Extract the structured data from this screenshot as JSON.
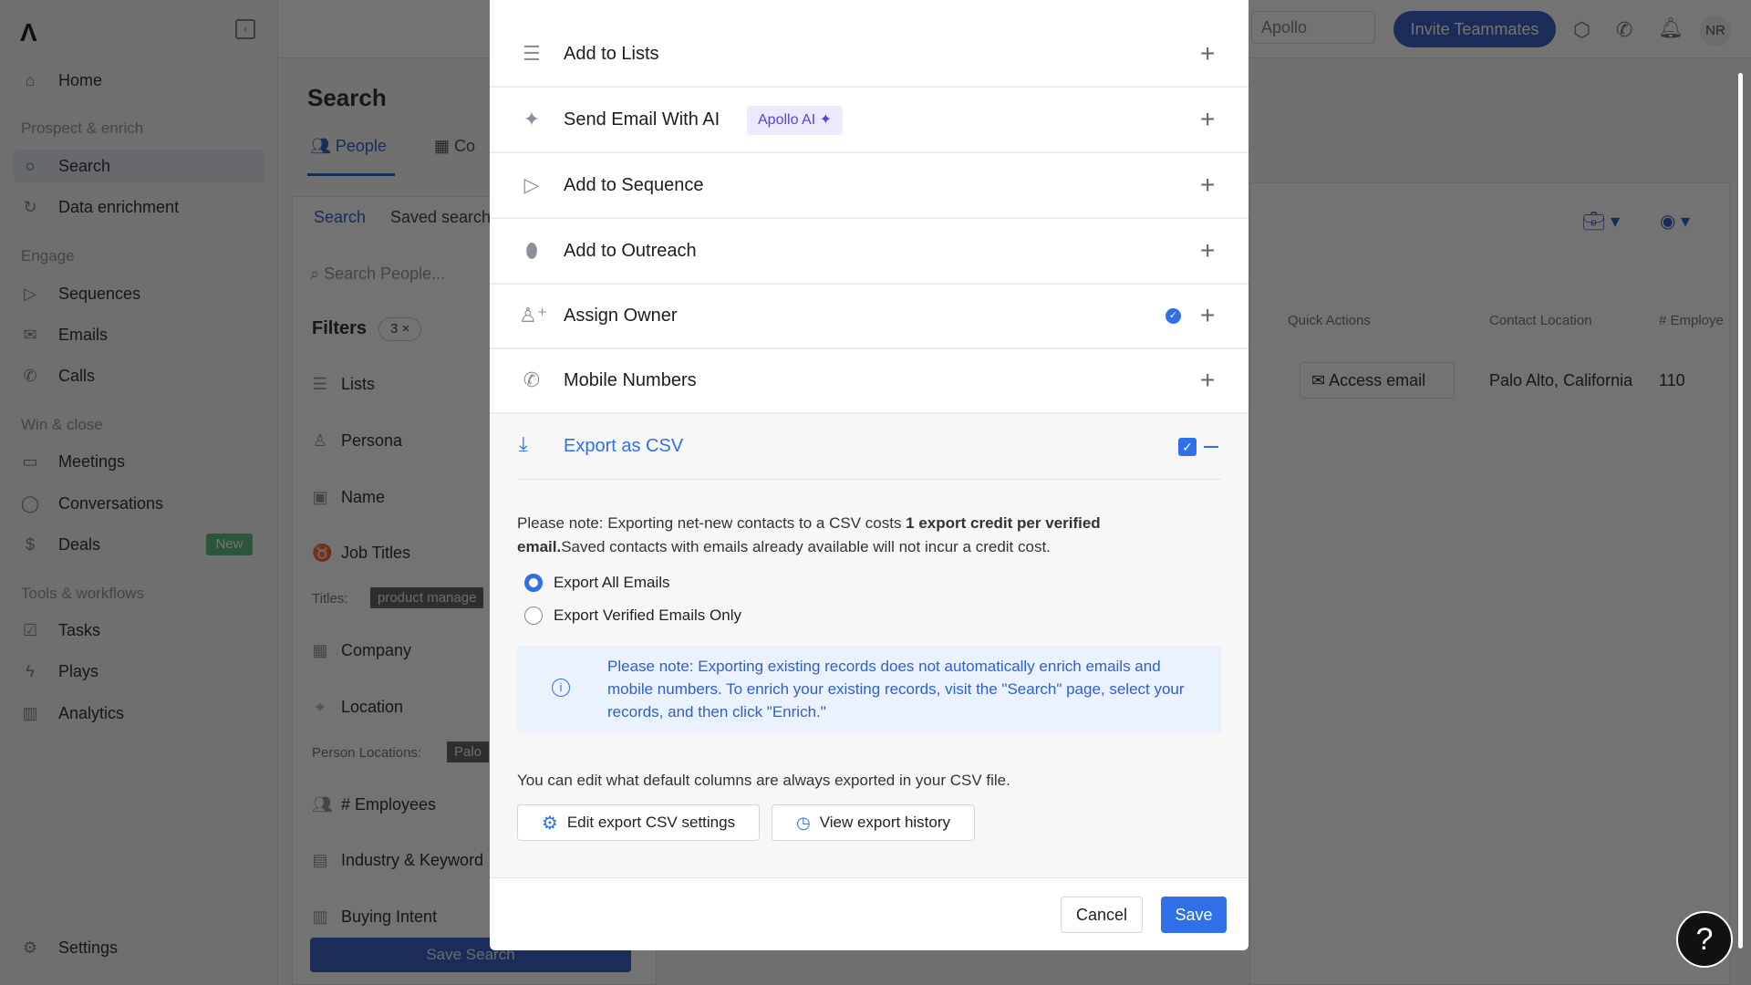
{
  "sidebar": {
    "items": {
      "home": "Home",
      "search": "Search",
      "data_enrichment": "Data enrichment",
      "sequences": "Sequences",
      "emails": "Emails",
      "calls": "Calls",
      "meetings": "Meetings",
      "conversations": "Conversations",
      "deals": "Deals",
      "deals_badge": "New",
      "tasks": "Tasks",
      "plays": "Plays",
      "analytics": "Analytics",
      "settings": "Settings"
    },
    "sections": {
      "prospect": "Prospect & enrich",
      "engage": "Engage",
      "win": "Win & close",
      "tools": "Tools & workflows"
    }
  },
  "topbar": {
    "search_placeholder": "Apollo",
    "invite": "Invite Teammates",
    "avatar": "NR"
  },
  "main": {
    "title": "Search",
    "tabs": [
      "People",
      "Co"
    ],
    "subtabs": [
      "Search",
      "Saved search"
    ],
    "search_placeholder": "Search People...",
    "filters_label": "Filters",
    "filters_count": "3",
    "filters": [
      "Lists",
      "Persona",
      "Name",
      "Job Titles",
      "Company",
      "Location",
      "# Employees",
      "Industry & Keyword",
      "Buying Intent"
    ],
    "titles_label": "Titles:",
    "titles_value": "product manage",
    "locations_label": "Person Locations:",
    "locations_value": "Palo",
    "save_search": "Save Search",
    "table": {
      "headers": [
        "Quick Actions",
        "Contact Location",
        "# Employe"
      ],
      "row": {
        "action": "Access email",
        "location": "Palo Alto, California",
        "employees": "110"
      }
    }
  },
  "modal": {
    "rows": [
      {
        "label": "Add to Lists",
        "icon": "list-add-icon"
      },
      {
        "label": "Send Email With AI",
        "icon": "sparkle-icon",
        "badge": "Apollo AI"
      },
      {
        "label": "Add to Sequence",
        "icon": "send-icon"
      },
      {
        "label": "Add to Outreach",
        "icon": "outreach-icon"
      },
      {
        "label": "Assign Owner",
        "icon": "user-plus-icon",
        "checked": true
      },
      {
        "label": "Mobile Numbers",
        "icon": "phone-icon"
      }
    ],
    "export": {
      "title": "Export as CSV",
      "checked": true,
      "note_prefix": "Please note: Exporting net-new contacts to a CSV costs ",
      "note_bold": "1 export credit per verified email.",
      "note_suffix": "Saved contacts with emails already available will not incur a credit cost.",
      "options": [
        "Export All Emails",
        "Export Verified Emails Only"
      ],
      "selected": "Export All Emails",
      "info": "Please note: Exporting existing records does not automatically enrich emails and mobile numbers. To enrich your existing records, visit the \"Search\" page, select your records, and then click \"Enrich.\"",
      "columns_note": "You can edit what default columns are always exported in your CSV file.",
      "edit_settings": "Edit export CSV settings",
      "view_history": "View export history"
    },
    "cancel": "Cancel",
    "save": "Save"
  },
  "help": "?",
  "colors": {
    "accent": "#2f6fe8",
    "ai_badge_bg": "#ece9ff",
    "ai_badge_text": "#5a3fd6",
    "info_bg": "#eaf2fd"
  }
}
